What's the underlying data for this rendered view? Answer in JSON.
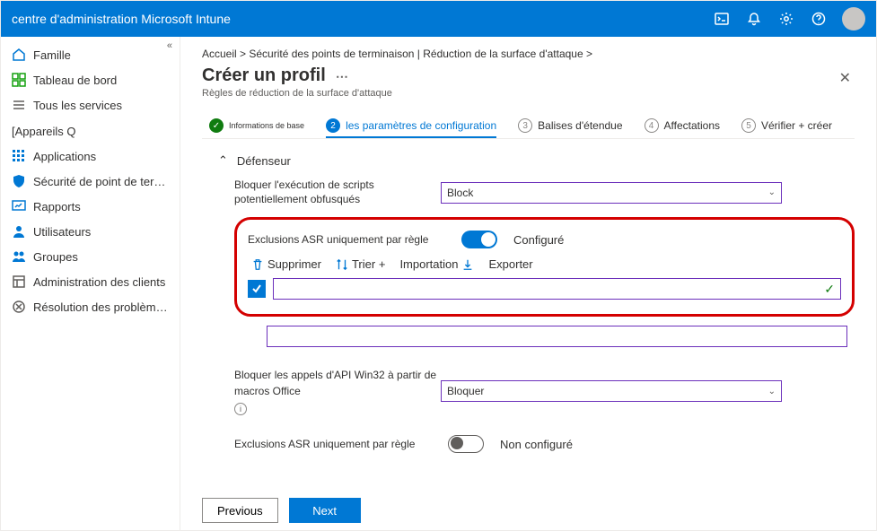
{
  "topbar": {
    "title": "centre d'administration Microsoft Intune"
  },
  "sidebar": {
    "items": [
      {
        "label": "Famille",
        "icon": "home"
      },
      {
        "label": "Tableau de bord",
        "icon": "dashboard"
      },
      {
        "label": "Tous les services",
        "icon": "list"
      }
    ],
    "section_label": "[Appareils Q",
    "items2": [
      {
        "label": "Applications",
        "icon": "apps"
      },
      {
        "label": "Sécurité de point de terminaison",
        "icon": "shield"
      },
      {
        "label": "Rapports",
        "icon": "reports"
      },
      {
        "label": "Utilisateurs",
        "icon": "users"
      },
      {
        "label": "Groupes",
        "icon": "groups"
      },
      {
        "label": "Administration des clients",
        "icon": "admin"
      },
      {
        "label": "Résolution des problèmes + support",
        "icon": "support"
      }
    ]
  },
  "breadcrumb": "Accueil > Sécurité des points de terminaison | Réduction de la surface d'attaque >",
  "page_title": "Créer un profil",
  "page_subtitle": "Règles de réduction de la surface d'attaque",
  "steps": {
    "s1": "Informations de base",
    "s2": "les paramètres de configuration",
    "s3": "Balises d'étendue",
    "s4": "Affectations",
    "s5": "Vérifier + créer"
  },
  "section": {
    "defender": "Défenseur",
    "block_script_label": "Bloquer l'exécution de scripts potentiellement obfusqués",
    "block_value": "Block",
    "asr_exclusions_label": "Exclusions ASR uniquement par règle",
    "configured": "Configuré",
    "not_configured": "Non configuré",
    "delete": "Supprimer",
    "sort": "Trier",
    "import": "Importation",
    "export": "Exporter",
    "block_win32_label": "Bloquer les appels d'API Win32 à partir de macros Office",
    "block_win32_value": "Bloquer"
  },
  "buttons": {
    "previous": "Previous",
    "next": "Next"
  }
}
